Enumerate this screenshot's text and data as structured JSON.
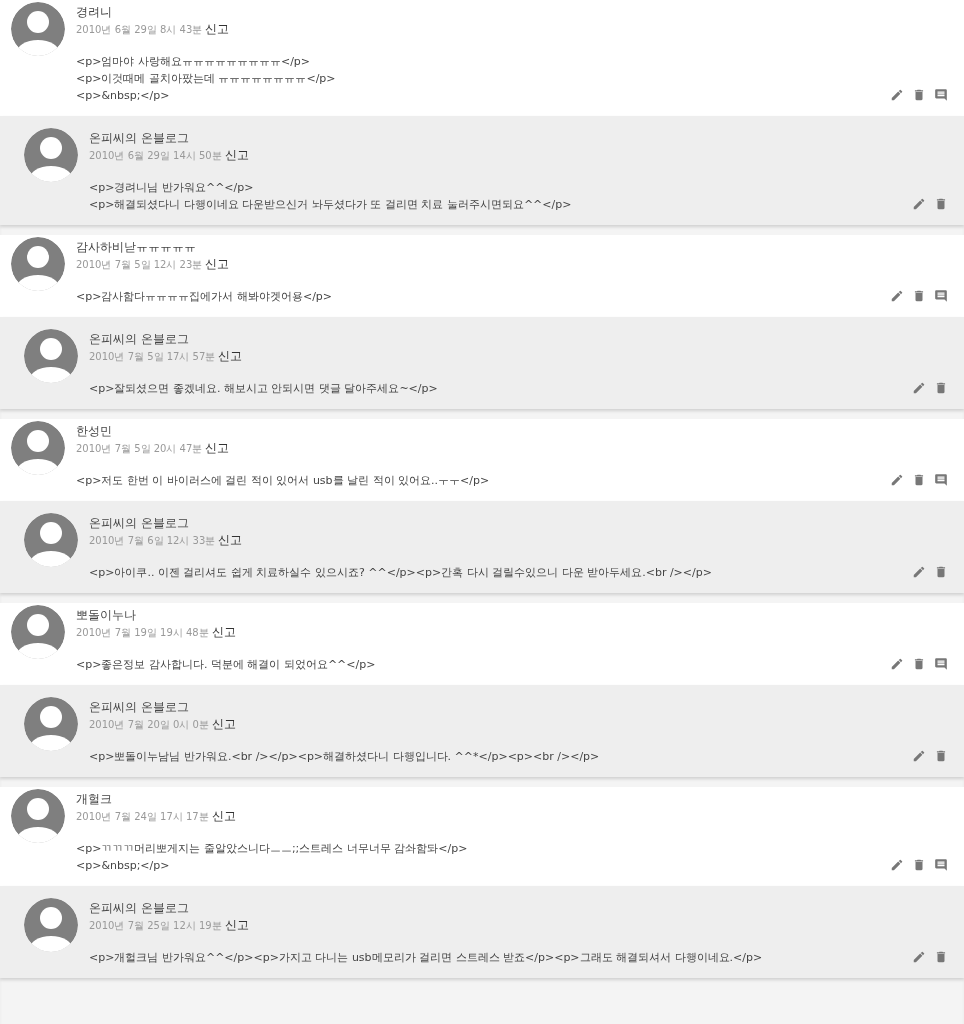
{
  "threads": [
    {
      "comment": {
        "author": "경려니",
        "date": "2010년 6월 29일 8시 43분",
        "report": "신고",
        "lines": [
          "<p>엄마야 사랑해요ㅠㅠㅠㅠㅠㅠㅠㅠㅠ</p>",
          "<p>이것때메 골치아팠는데 ㅠㅠㅠㅠㅠㅠㅠㅠ</p>",
          "<p>&nbsp;</p>"
        ]
      },
      "reply": {
        "author": "온피씨의 온블로그",
        "date": "2010년 6월 29일 14시 50분",
        "report": "신고",
        "lines": [
          "<p>경려니님 반가워요^^</p>",
          "<p>해결되셨다니 다행이네요 다운받으신거 놔두셨다가 또 걸리면 치료 눌러주시면되요^^</p>"
        ]
      }
    },
    {
      "comment": {
        "author": "감사하비낟ㅠㅠㅠㅠㅠ",
        "date": "2010년 7월 5일 12시 23분",
        "report": "신고",
        "lines": [
          "<p>감사함다ㅠㅠㅠㅠ집에가서 해봐야겟어용</p>"
        ]
      },
      "reply": {
        "author": "온피씨의 온블로그",
        "date": "2010년 7월 5일 17시 57분",
        "report": "신고",
        "lines": [
          "<p>잘되셨으면 좋겠네요. 해보시고 안되시면 댓글 달아주세요~</p>"
        ]
      }
    },
    {
      "comment": {
        "author": "한성민",
        "date": "2010년 7월 5일 20시 47분",
        "report": "신고",
        "lines": [
          "<p>저도 한번 이 바이러스에 걸린 적이 있어서 usb를 날린 적이 있어요..ㅜㅜ</p>"
        ]
      },
      "reply": {
        "author": "온피씨의 온블로그",
        "date": "2010년 7월 6일 12시 33분",
        "report": "신고",
        "lines": [
          "<p>아이쿠.. 이젠 걸리셔도 쉽게 치료하실수 있으시죠? ^^</p><p>간혹 다시 걸릴수있으니 다운 받아두세요.<br /></p>"
        ]
      }
    },
    {
      "comment": {
        "author": "뽀돌이누나",
        "date": "2010년 7월 19일 19시 48분",
        "report": "신고",
        "lines": [
          "<p>좋은정보 감사합니다. 덕분에 해결이 되었어요^^</p>"
        ]
      },
      "reply": {
        "author": "온피씨의 온블로그",
        "date": "2010년 7월 20일 0시 0분",
        "report": "신고",
        "lines": [
          "<p>뽀돌이누남님 반가워요.<br /></p><p>해결하셨다니 다행입니다. ^^*</p><p><br /></p>"
        ]
      }
    },
    {
      "comment": {
        "author": "개헐크",
        "date": "2010년 7월 24일 17시 17분",
        "report": "신고",
        "lines": [
          "<p>ㄲㄲㄲ머리뽀게지는 줄알았스니다ㅡㅡ;;스트레스 너무너무 감솨함돠</p>",
          "<p>&nbsp;</p>"
        ]
      },
      "reply": {
        "author": "온피씨의 온블로그",
        "date": "2010년 7월 25일 12시 19분",
        "report": "신고",
        "lines": [
          "<p>개헐크님 반가워요^^</p><p>가지고 다니는 usb메모리가 걸리면 스트레스 받죠</p><p>그래도 해결되셔서 다행이네요.</p>"
        ]
      }
    }
  ]
}
